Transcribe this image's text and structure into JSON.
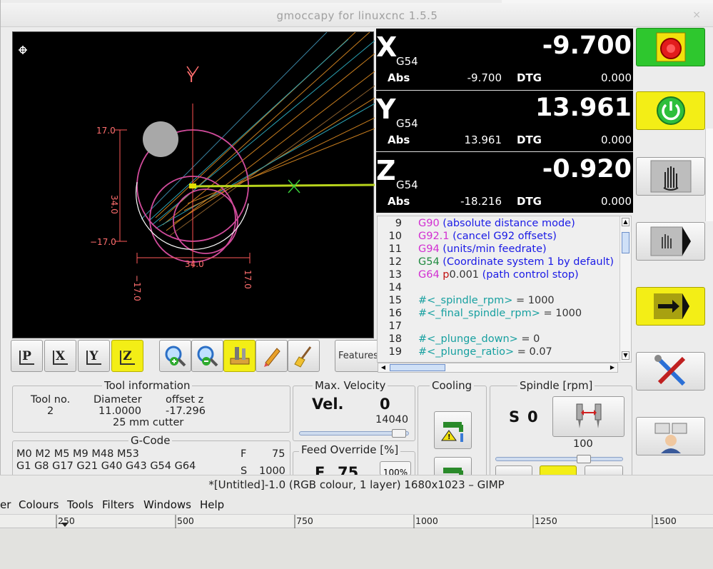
{
  "window": {
    "title": "gmoccapy for linuxcnc   1.5.5",
    "close_glyph": "×"
  },
  "preview": {
    "labels": {
      "y_axis": "Y",
      "x_marker": "X",
      "top": "17.0",
      "bottom": "−17.0",
      "height": "34.0",
      "width": "34.0",
      "left": "−17.0",
      "right": "17.0"
    }
  },
  "view_bar": {
    "buttons": [
      {
        "label": "P",
        "name": "view-p-button",
        "active": false
      },
      {
        "label": "X",
        "name": "view-x-button",
        "active": false
      },
      {
        "label": "Y",
        "name": "view-y-button",
        "active": false
      },
      {
        "label": "Z",
        "name": "view-z-button",
        "active": true
      }
    ],
    "features_label": "Features"
  },
  "dro": [
    {
      "axis": "X",
      "system": "G54",
      "value": "-9.700",
      "abs_label": "Abs",
      "abs": "-9.700",
      "dtg_label": "DTG",
      "dtg": "0.000"
    },
    {
      "axis": "Y",
      "system": "G54",
      "value": "13.961",
      "abs_label": "Abs",
      "abs": "13.961",
      "dtg_label": "DTG",
      "dtg": "0.000"
    },
    {
      "axis": "Z",
      "system": "G54",
      "value": "-0.920",
      "abs_label": "Abs",
      "abs": "-18.216",
      "dtg_label": "DTG",
      "dtg": "0.000"
    }
  ],
  "gcode_view": {
    "lines": [
      {
        "n": "9",
        "parts": [
          [
            "G90",
            "mag"
          ],
          [
            " (absolute distance mode)",
            "blue"
          ]
        ]
      },
      {
        "n": "10",
        "parts": [
          [
            "G92.1",
            "mag"
          ],
          [
            " (cancel G92 offsets)",
            "blue"
          ]
        ]
      },
      {
        "n": "11",
        "parts": [
          [
            "G94",
            "mag"
          ],
          [
            " (units/min feedrate)",
            "blue"
          ]
        ]
      },
      {
        "n": "12",
        "parts": [
          [
            "G54",
            "green"
          ],
          [
            " (Coordinate system 1 by default)",
            "blue"
          ]
        ]
      },
      {
        "n": "13",
        "parts": [
          [
            "G64 ",
            "mag"
          ],
          [
            "p",
            "red"
          ],
          [
            "0.001 ",
            "dark"
          ],
          [
            "(path control stop)",
            "blue"
          ]
        ]
      },
      {
        "n": "14",
        "parts": []
      },
      {
        "n": "15",
        "parts": [
          [
            "#<_spindle_rpm>",
            "teal"
          ],
          [
            " = 1000",
            "dark"
          ]
        ]
      },
      {
        "n": "16",
        "parts": [
          [
            "#<_final_spindle_rpm>",
            "teal"
          ],
          [
            " = 1000",
            "dark"
          ]
        ]
      },
      {
        "n": "17",
        "parts": []
      },
      {
        "n": "18",
        "parts": [
          [
            "#<_plunge_down>",
            "teal"
          ],
          [
            " = 0",
            "dark"
          ]
        ]
      },
      {
        "n": "19",
        "parts": [
          [
            "#<_plunge_ratio>",
            "teal"
          ],
          [
            " = 0.07",
            "dark"
          ]
        ]
      }
    ]
  },
  "tool_info": {
    "title": "Tool information",
    "tool_no_label": "Tool no.",
    "tool_no": "2",
    "diameter_label": "Diameter",
    "diameter": "11.0000",
    "offset_label": "offset z",
    "offset": "-17.296",
    "description": "25 mm cutter"
  },
  "gcode_status": {
    "title": "G-Code",
    "line1": "M0 M2 M5 M9 M48 M53",
    "line2": "G1 G8 G17 G21 G40 G43 G54 G64",
    "f_label": "F",
    "f_value": "75",
    "s_label": "S",
    "s_value": "1000"
  },
  "velocity": {
    "title": "Max. Velocity",
    "label": "Vel.",
    "value": "0",
    "max": "14040",
    "slider_fraction": 0.98
  },
  "feed_override": {
    "title": "Feed Override [%]",
    "label": "F",
    "value": "75",
    "button": "100%"
  },
  "cooling": {
    "title": "Cooling"
  },
  "spindle": {
    "title": "Spindle [rpm]",
    "label": "S",
    "value": "0",
    "override": "100",
    "slider_fraction": 0.72
  },
  "gimp": {
    "title": "*[Untitled]-1.0 (RGB colour, 1 layer) 1680x1023 – GIMP",
    "menu": [
      "er",
      "Colours",
      "Tools",
      "Filters",
      "Windows",
      "Help"
    ],
    "ruler": [
      "250",
      "500",
      "750",
      "1000",
      "1250",
      "1500"
    ]
  }
}
